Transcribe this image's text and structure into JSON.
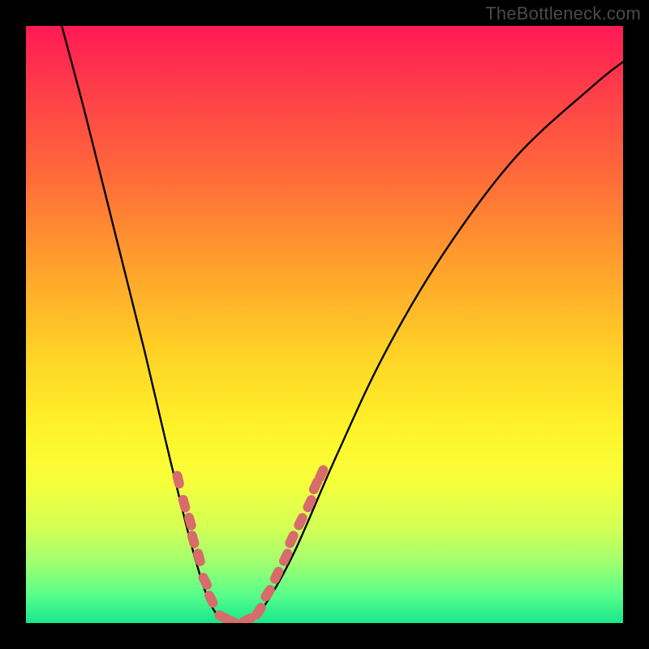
{
  "watermark": "TheBottleneck.com",
  "chart_data": {
    "type": "line",
    "title": "",
    "xlabel": "",
    "ylabel": "",
    "xlim": [
      0,
      100
    ],
    "ylim": [
      0,
      100
    ],
    "background_gradient": {
      "top": "#ff1a55",
      "bottom": "#17e88a"
    },
    "curve": {
      "name": "bottleneck-curve",
      "points": [
        {
          "x": 6,
          "y": 100
        },
        {
          "x": 10,
          "y": 85
        },
        {
          "x": 15,
          "y": 65
        },
        {
          "x": 20,
          "y": 45
        },
        {
          "x": 24,
          "y": 28
        },
        {
          "x": 28,
          "y": 12
        },
        {
          "x": 31,
          "y": 3
        },
        {
          "x": 34,
          "y": 0
        },
        {
          "x": 37,
          "y": 0
        },
        {
          "x": 40,
          "y": 3
        },
        {
          "x": 45,
          "y": 12
        },
        {
          "x": 52,
          "y": 28
        },
        {
          "x": 60,
          "y": 45
        },
        {
          "x": 70,
          "y": 62
        },
        {
          "x": 82,
          "y": 78
        },
        {
          "x": 95,
          "y": 90
        },
        {
          "x": 100,
          "y": 94
        }
      ]
    },
    "markers": {
      "color": "#d86b6b",
      "points": [
        {
          "x": 25.5,
          "y": 24
        },
        {
          "x": 26.5,
          "y": 20
        },
        {
          "x": 27.5,
          "y": 17
        },
        {
          "x": 28.0,
          "y": 14
        },
        {
          "x": 29.0,
          "y": 11
        },
        {
          "x": 30.0,
          "y": 7
        },
        {
          "x": 31.0,
          "y": 4
        },
        {
          "x": 33.0,
          "y": 1
        },
        {
          "x": 35.0,
          "y": 0
        },
        {
          "x": 37.0,
          "y": 0.5
        },
        {
          "x": 39.0,
          "y": 2
        },
        {
          "x": 40.5,
          "y": 5
        },
        {
          "x": 42.0,
          "y": 8
        },
        {
          "x": 43.5,
          "y": 11
        },
        {
          "x": 44.5,
          "y": 14
        },
        {
          "x": 46.0,
          "y": 17
        },
        {
          "x": 47.5,
          "y": 20
        },
        {
          "x": 48.5,
          "y": 23
        },
        {
          "x": 49.5,
          "y": 25
        }
      ]
    }
  }
}
